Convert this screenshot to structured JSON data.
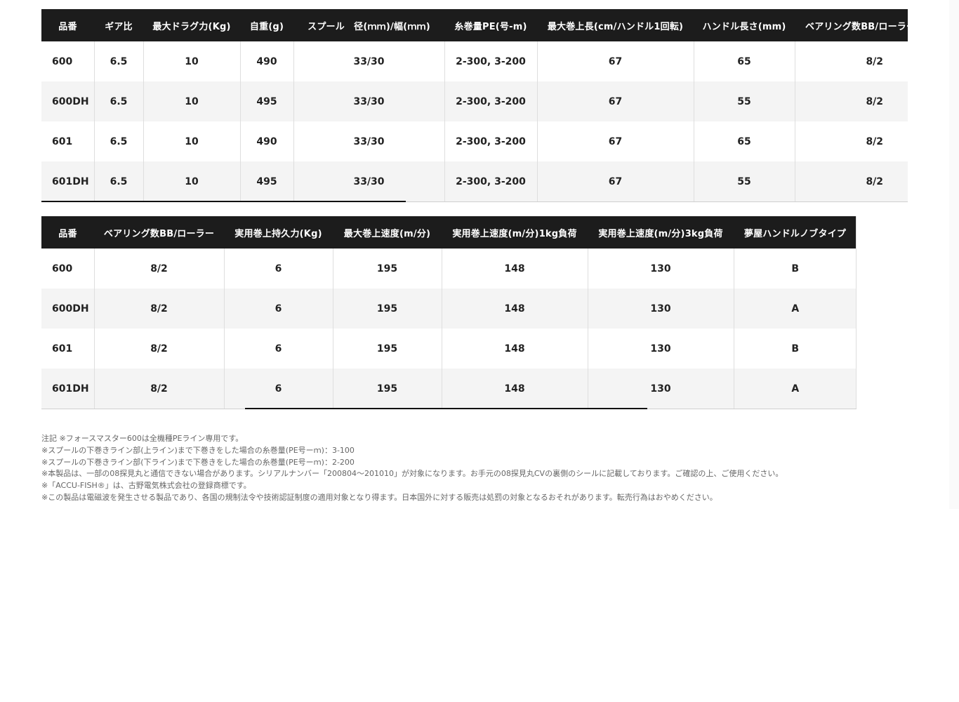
{
  "table1": {
    "headers": [
      "品番",
      "ギア比",
      "最大ドラグ力(Kg)",
      "自重(g)",
      "スプール　径(ｍｍ)/幅(ｍｍ)",
      "糸巻量PE(号-m)",
      "最大巻上長(cm/ハンドル1回転)",
      "ハンドル長さ(mm)",
      "ベアリング数BB/ローラー"
    ],
    "rows": [
      [
        "600",
        "6.5",
        "10",
        "490",
        "33/30",
        "2-300, 3-200",
        "67",
        "65",
        "8/2"
      ],
      [
        "600DH",
        "6.5",
        "10",
        "495",
        "33/30",
        "2-300, 3-200",
        "67",
        "55",
        "8/2"
      ],
      [
        "601",
        "6.5",
        "10",
        "490",
        "33/30",
        "2-300, 3-200",
        "67",
        "65",
        "8/2"
      ],
      [
        "601DH",
        "6.5",
        "10",
        "495",
        "33/30",
        "2-300, 3-200",
        "67",
        "55",
        "8/2"
      ]
    ]
  },
  "table2": {
    "headers": [
      "品番",
      "ベアリング数BB/ローラー",
      "実用巻上持久力(Kg)",
      "最大巻上速度(m/分)",
      "実用巻上速度(m/分)1kg負荷",
      "実用巻上速度(m/分)3kg負荷",
      "夢屋ハンドルノブタイプ"
    ],
    "rows": [
      [
        "600",
        "8/2",
        "6",
        "195",
        "148",
        "130",
        "B"
      ],
      [
        "600DH",
        "8/2",
        "6",
        "195",
        "148",
        "130",
        "A"
      ],
      [
        "601",
        "8/2",
        "6",
        "195",
        "148",
        "130",
        "B"
      ],
      [
        "601DH",
        "8/2",
        "6",
        "195",
        "148",
        "130",
        "A"
      ]
    ]
  },
  "notes": [
    "注記 ※フォースマスター600は全機種PEライン専用です。",
    "※スプールの下巻きライン部(上ライン)まで下巻きをした場合の糸巻量(PE号ーｍ)：3-100",
    "※スプールの下巻きライン部(下ライン)まで下巻きをした場合の糸巻量(PE号ーｍ)：2-200",
    "※本製品は、一部の08探見丸と通信できない場合があります。シリアルナンバー「200804～201010」が対象になります。お手元の08探見丸CVの裏側のシールに記載しております。ご確認の上、ご使用ください。",
    "※「ACCU-FISH®」は、古野電気株式会社の登録商標です。",
    "※この製品は電磁波を発生させる製品であり、各国の規制法令や技術認証制度の適用対象となり得ます。日本国外に対する販売は処罰の対象となるおそれがあります。転売行為はおやめください。"
  ]
}
